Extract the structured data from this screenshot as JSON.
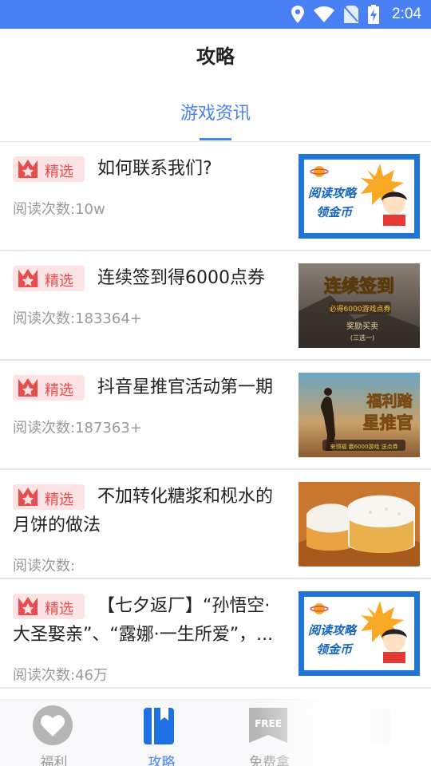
{
  "status_bar": {
    "time": "2:04"
  },
  "header": {
    "title": "攻略"
  },
  "tabs": [
    {
      "label": "游戏资讯",
      "active": true
    }
  ],
  "articles": [
    {
      "badge": "精选",
      "title": "如何联系我们?",
      "read_count": "阅读次数:10w",
      "thumbnail": {
        "lines": [
          "阅读攻略",
          "领金币"
        ]
      }
    },
    {
      "badge": "精选",
      "title": "连续签到得6000点券",
      "read_count": "阅读次数:183364+",
      "thumbnail": {
        "lines": [
          "连续签到",
          "必得6000游戏点券",
          "奖励买卖",
          "(三选一)"
        ]
      }
    },
    {
      "badge": "精选",
      "title": "抖音星推官活动第一期",
      "read_count": "阅读次数:187363+",
      "thumbnail": {
        "lines": [
          "福利踏",
          "星推官",
          "来领福 赢6000游戏 送点券"
        ]
      }
    },
    {
      "badge": "精选",
      "title": "不加转化糖浆和枧水的月饼的做法",
      "read_count": "阅读次数:",
      "thumbnail": {
        "lines": []
      }
    },
    {
      "badge": "精选",
      "title": "【七夕返厂】“孙悟空·大圣娶亲”、“露娜·一生所爱”，...",
      "read_count": "阅读次数:46万",
      "thumbnail": {
        "lines": [
          "阅读攻略",
          "领金币"
        ]
      }
    }
  ],
  "bottom_nav": [
    {
      "label": "福利",
      "icon": "heart-icon",
      "active": false
    },
    {
      "label": "攻略",
      "icon": "book-icon",
      "active": true
    },
    {
      "label": "免费拿",
      "icon": "free-tag-icon",
      "active": false
    },
    {
      "label": "",
      "icon": "profile-icon",
      "active": false
    }
  ],
  "colors": {
    "accent": "#4a80f5",
    "badge_bg": "#fde3e3",
    "badge_text": "#e84c4c"
  }
}
